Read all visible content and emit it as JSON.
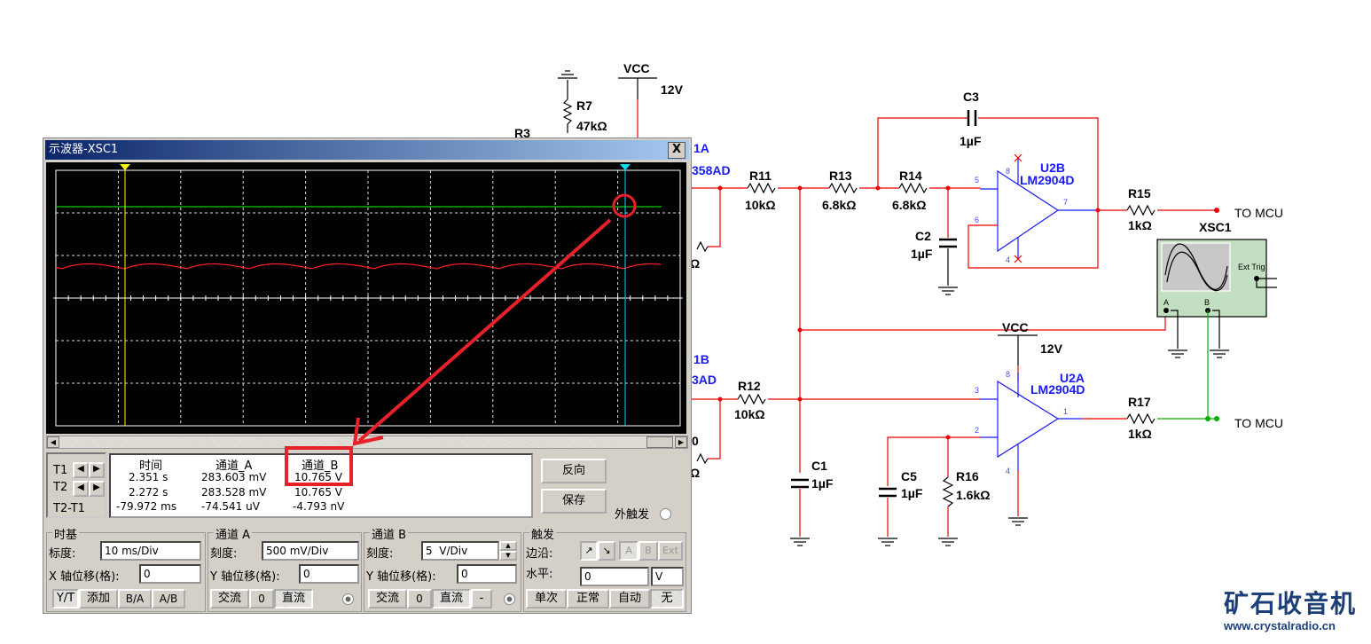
{
  "schematic": {
    "top": {
      "r3": "R3",
      "r7": "R7",
      "r7_val": "47kΩ",
      "vcc": "VCC",
      "vcc_val": "12V"
    },
    "left": {
      "u1a": "1A",
      "u1a_part": "358AD",
      "u1b": "1B",
      "u1b_part": "3AD",
      "ohm1": "Ω",
      "ohm2": "Ω",
      "zero": "0"
    },
    "r11": "R11",
    "r11_val": "10kΩ",
    "r13": "R13",
    "r13_val": "6.8kΩ",
    "r14": "R14",
    "r14_val": "6.8kΩ",
    "c3": "C3",
    "c3_val": "1µF",
    "c2": "C2",
    "c2_val": "1µF",
    "u2b": "U2B",
    "u2b_part": "LM2904D",
    "u2b_pins": [
      "5",
      "6",
      "7",
      "8",
      "4"
    ],
    "r15": "R15",
    "r15_val": "1kΩ",
    "to_mcu_1": "TO MCU",
    "xsc1": "XSC1",
    "ext_trig": "Ext Trig",
    "term_a": "A",
    "term_b": "B",
    "vcc2": "VCC",
    "vcc2_val": "12V",
    "u2a": "U2A",
    "u2a_part": "LM2904D",
    "u2a_pins": [
      "3",
      "2",
      "1",
      "8",
      "4"
    ],
    "r12": "R12",
    "r12_val": "10kΩ",
    "c1": "C1",
    "c1_val": "1µF",
    "c5": "C5",
    "c5_val": "1µF",
    "r16": "R16",
    "r16_val": "1.6kΩ",
    "r17": "R17",
    "r17_val": "1kΩ",
    "to_mcu_2": "TO MCU"
  },
  "scope": {
    "title": "示波器-XSC1",
    "close": "X",
    "colors": {
      "channel_a": "#ff2020",
      "channel_b": "#00cc00",
      "cursor_t1": "#ffff00",
      "cursor_t2": "#00e0ff"
    },
    "measure": {
      "headers": [
        "时间",
        "通道_A",
        "通道_B"
      ],
      "rows": [
        {
          "label": "T1",
          "time": "2.351 s",
          "a": "283.603 mV",
          "b": "10.765 V"
        },
        {
          "label": "T2",
          "time": "2.272 s",
          "a": "283.528 mV",
          "b": "10.765 V"
        },
        {
          "label": "T2-T1",
          "time": "-79.972 ms",
          "a": "-74.541 uV",
          "b": "-4.793 nV"
        }
      ]
    },
    "reverse": "反向",
    "save": "保存",
    "ext_trigger": "外触发",
    "timebase": {
      "title": "时基",
      "scale_label": "标度:",
      "scale": "10 ms/Div",
      "xpos_label": "X 轴位移(格):",
      "xpos": "0",
      "modes": [
        "Y/T",
        "添加",
        "B/A",
        "A/B"
      ],
      "active": "Y/T"
    },
    "channel_a": {
      "title": "通道 A",
      "scale_label": "刻度:",
      "scale": "500 mV/Div",
      "ypos_label": "Y 轴位移(格):",
      "ypos": "0",
      "coupling": [
        "交流",
        "0",
        "直流"
      ],
      "active": "直流"
    },
    "channel_b": {
      "title": "通道 B",
      "scale_label": "刻度:",
      "scale": "5  V/Div",
      "ypos_label": "Y 轴位移(格):",
      "ypos": "0",
      "coupling": [
        "交流",
        "0",
        "直流",
        "-"
      ],
      "active": "直流"
    },
    "trigger": {
      "title": "触发",
      "edge_label": "边沿:",
      "edges": [
        "↗",
        "↘"
      ],
      "sources": [
        "A",
        "B",
        "Ext"
      ],
      "level_label": "水平:",
      "level": "0",
      "unit": "V",
      "modes": [
        "单次",
        "正常",
        "自动",
        "无"
      ],
      "active": "无"
    }
  },
  "watermark": {
    "name": "矿石收音机",
    "url": "www.crystalradio.cn"
  }
}
